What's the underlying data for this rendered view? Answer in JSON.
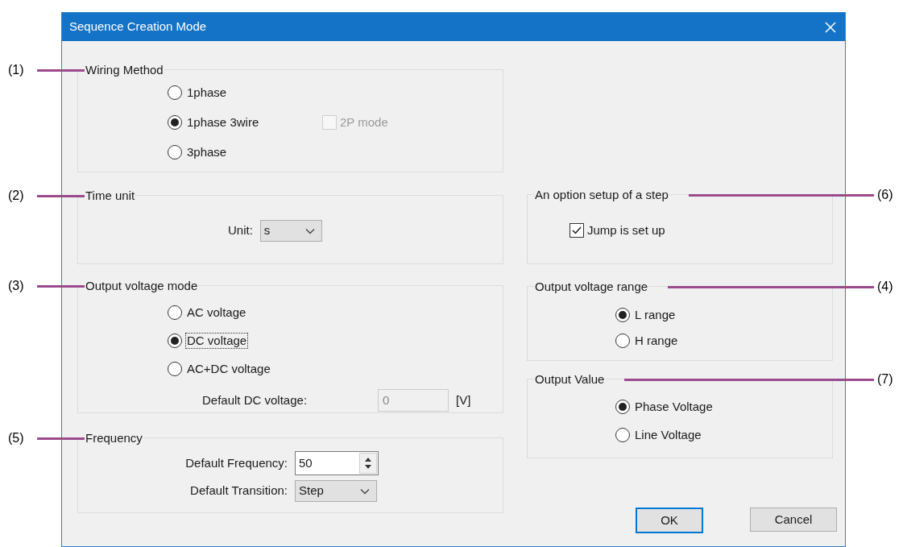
{
  "window": {
    "title": "Sequence Creation Mode"
  },
  "left_column": [
    {
      "title": "Wiring Method",
      "callout": "(1)",
      "items": [
        {
          "kind": "radio",
          "label": "1phase",
          "selected": false,
          "focused": false
        },
        {
          "kind": "radio",
          "label": "1phase 3wire",
          "selected": true,
          "focused": false,
          "option": {
            "label": "2P mode",
            "checked": false,
            "disabled": true
          }
        },
        {
          "kind": "radio",
          "label": "3phase",
          "selected": false,
          "focused": false
        }
      ]
    },
    {
      "title": "Time unit",
      "callout": "(2)",
      "items": [
        {
          "kind": "combo",
          "label": "Unit:",
          "value": "s"
        }
      ]
    },
    {
      "title": "Output voltage mode",
      "callout": "(3)",
      "items": [
        {
          "kind": "radio",
          "label": "AC voltage",
          "selected": false,
          "focused": false
        },
        {
          "kind": "radio",
          "label": "DC voltage",
          "selected": true,
          "focused": true
        },
        {
          "kind": "radio",
          "label": "AC+DC voltage",
          "selected": false,
          "focused": false
        },
        {
          "kind": "field",
          "label": "Default DC voltage:",
          "value": "0",
          "unit": "[V]",
          "disabled": true
        }
      ]
    },
    {
      "title": "Frequency",
      "callout": "(5)",
      "items": [
        {
          "kind": "spin",
          "label": "Default Frequency:",
          "value": "50"
        },
        {
          "kind": "combo",
          "label": "Default Transition:",
          "value": "Step"
        }
      ]
    }
  ],
  "right_column": [
    {
      "title": "An option setup of a step",
      "callout": "(6)",
      "items": [
        {
          "kind": "checkbox",
          "label": "Jump is set up",
          "checked": true,
          "disabled": false
        }
      ]
    },
    {
      "title": "Output voltage range",
      "callout": "(4)",
      "items": [
        {
          "kind": "radio",
          "label": "L range",
          "selected": true,
          "focused": false
        },
        {
          "kind": "radio",
          "label": "H range",
          "selected": false,
          "focused": false
        }
      ]
    },
    {
      "title": "Output Value",
      "callout": "(7)",
      "items": [
        {
          "kind": "radio",
          "label": "Phase Voltage",
          "selected": true,
          "focused": false
        },
        {
          "kind": "radio",
          "label": "Line Voltage",
          "selected": false,
          "focused": false
        }
      ]
    }
  ],
  "buttons": [
    {
      "label": "OK",
      "default": true
    },
    {
      "label": "Cancel",
      "default": false
    }
  ]
}
